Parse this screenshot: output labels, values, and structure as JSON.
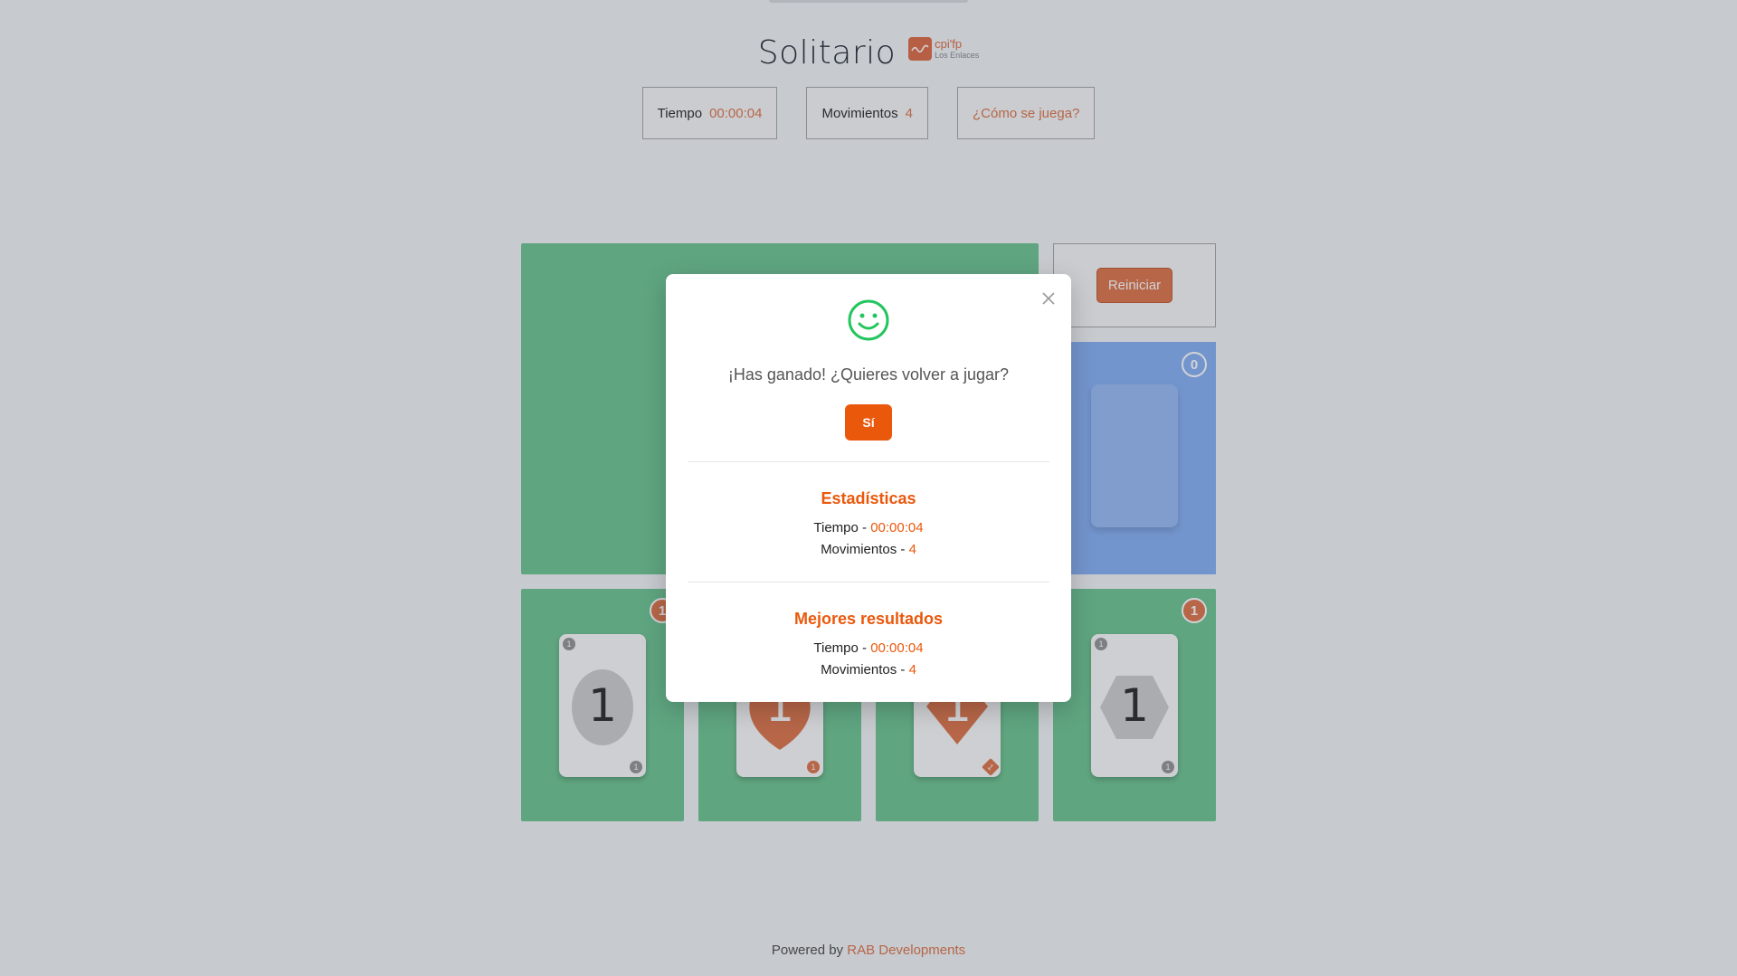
{
  "header": {
    "title": "Solitario",
    "logo_top": "cpi'fp",
    "logo_bottom": "Los Enlaces"
  },
  "stats": {
    "time_label": "Tiempo",
    "time_value": "00:00:04",
    "moves_label": "Movimientos",
    "moves_value": "4",
    "howto_label": "¿Cómo se juega?"
  },
  "board": {
    "restart_label": "Reiniciar",
    "deck_count": "0",
    "piles": [
      {
        "count": "1",
        "rank": "1",
        "suit": "circle",
        "color": "#555555"
      },
      {
        "count": "1",
        "rank": "1",
        "suit": "heart",
        "color": "#e07a52"
      },
      {
        "count": "1",
        "rank": "1",
        "suit": "diamond",
        "color": "#e07a52"
      },
      {
        "count": "1",
        "rank": "1",
        "suit": "hexagon",
        "color": "#555555"
      }
    ]
  },
  "modal": {
    "message": "¡Has ganado! ¿Quieres volver a jugar?",
    "yes_label": "Sí",
    "stats_title": "Estadísticas",
    "stats_time_label": "Tiempo - ",
    "stats_time_value": "00:00:04",
    "stats_moves_label": "Movimientos - ",
    "stats_moves_value": "4",
    "best_title": "Mejores resultados",
    "best_time_label": "Tiempo - ",
    "best_time_value": "00:00:04",
    "best_moves_label": "Movimientos - ",
    "best_moves_value": "4"
  },
  "footer": {
    "prefix": "Powered by ",
    "brand": "RAB Developments"
  },
  "colors": {
    "accent": "#e07a52",
    "modal_accent": "#ea580c",
    "board_green": "#75c796",
    "deck_blue": "#8db4f5",
    "smile_green": "#22c55e"
  }
}
